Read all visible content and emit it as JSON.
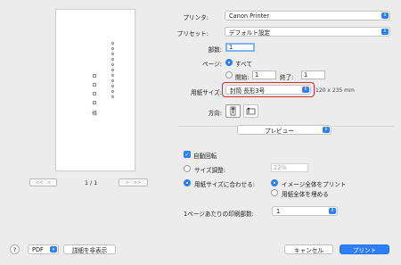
{
  "printer": {
    "label": "プリンタ:",
    "value": "Canon Printer"
  },
  "preset": {
    "label": "プリセット:",
    "value": "デフォルト設定"
  },
  "copies": {
    "label": "部数:",
    "value": "1"
  },
  "pages": {
    "label": "ページ:",
    "all_label": "すべて",
    "start_label": "開始:",
    "start_value": "1",
    "end_label": "終了:",
    "end_value": "1"
  },
  "paper_size": {
    "label": "用紙サイズ:",
    "value": "封筒 長形3号",
    "dimensions": "120 x 235 mm"
  },
  "orientation": {
    "label": "方向:"
  },
  "section_popup": {
    "value": "プレビュー"
  },
  "auto_rotate": {
    "label": "自動回転"
  },
  "scale": {
    "label": "サイズ調整:",
    "value": "22%"
  },
  "fit_paper": {
    "label": "用紙サイズに合わせる:",
    "print_entire": "イメージ全体をプリント",
    "fill_entire": "用紙全体を埋める"
  },
  "copies_per_page": {
    "label": "1ページあたりの印刷部数:",
    "value": "1"
  },
  "preview": {
    "page_indicator": "1 / 1",
    "addressee": "様"
  },
  "footer": {
    "help": "?",
    "pdf": "PDF",
    "hide_details": "詳細を非表示",
    "cancel": "キャンセル",
    "print": "プリント"
  },
  "colors": {
    "accent": "#2d7ef7",
    "highlight": "#d6262f"
  }
}
